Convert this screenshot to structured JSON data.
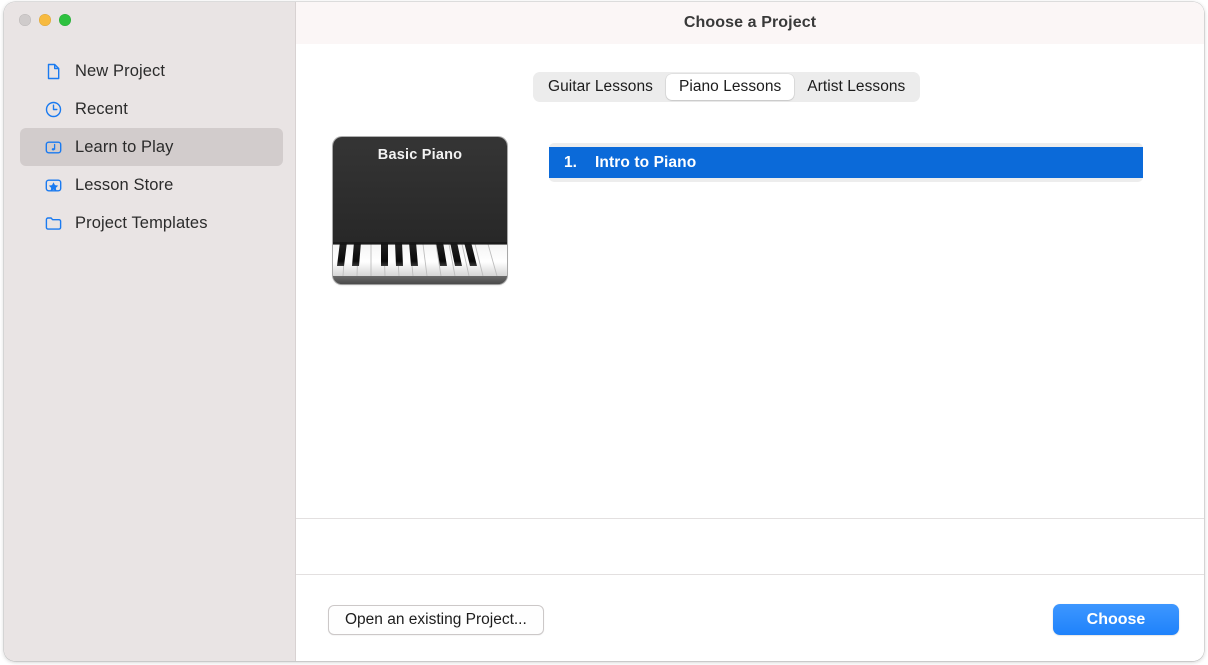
{
  "window": {
    "title": "Choose a Project",
    "traffic_lights": [
      {
        "name": "close",
        "color": "#cfcbcb"
      },
      {
        "name": "minimize",
        "color": "#f7ba3f"
      },
      {
        "name": "maximize",
        "color": "#2ec13f"
      }
    ]
  },
  "sidebar": {
    "items": [
      {
        "label": "New Project",
        "icon": "document-icon",
        "selected": false
      },
      {
        "label": "Recent",
        "icon": "clock-icon",
        "selected": false
      },
      {
        "label": "Learn to Play",
        "icon": "music-note-icon",
        "selected": true
      },
      {
        "label": "Lesson Store",
        "icon": "star-icon",
        "selected": false
      },
      {
        "label": "Project Templates",
        "icon": "folder-icon",
        "selected": false
      }
    ],
    "icon_color": "#1a7af0",
    "selected_bg": "#d2cccc"
  },
  "tabs": {
    "items": [
      {
        "label": "Guitar Lessons",
        "active": false
      },
      {
        "label": "Piano Lessons",
        "active": true
      },
      {
        "label": "Artist Lessons",
        "active": false
      }
    ],
    "track_color": "#ececec"
  },
  "thumbnail": {
    "title": "Basic Piano",
    "background": "#2c2c2c"
  },
  "lessons": {
    "rows": [
      {
        "number": "1.",
        "title": "Intro to Piano",
        "selected": true
      }
    ],
    "selected_color": "#0b6ad9",
    "list_bg": "#ededed"
  },
  "footer": {
    "open_label": "Open an existing Project...",
    "choose_label": "Choose",
    "choose_color": "#2d8cff"
  }
}
